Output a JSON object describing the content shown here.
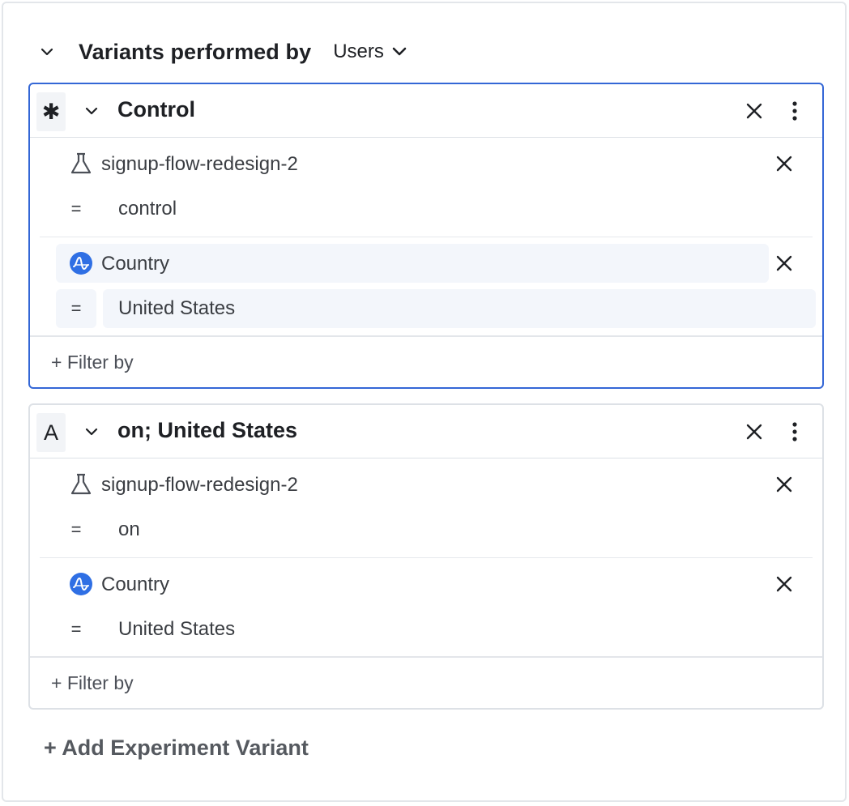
{
  "section": {
    "title": "Variants performed by",
    "scope_label": "Users"
  },
  "variants": [
    {
      "badge": "✱",
      "title": "Control",
      "filters": [
        {
          "icon": "flask-icon",
          "property": "signup-flow-redesign-2",
          "operator": "=",
          "value": "control"
        },
        {
          "icon": "amplitude-logo-icon",
          "property": "Country",
          "operator": "=",
          "value": "United States"
        }
      ],
      "filter_by_label": "+ Filter by"
    },
    {
      "badge": "A",
      "title": "on; United States",
      "filters": [
        {
          "icon": "flask-icon",
          "property": "signup-flow-redesign-2",
          "operator": "=",
          "value": "on"
        },
        {
          "icon": "amplitude-logo-icon",
          "property": "Country",
          "operator": "=",
          "value": "United States"
        }
      ],
      "filter_by_label": "+ Filter by"
    }
  ],
  "add_variant_label": "+ Add Experiment Variant",
  "colors": {
    "accent": "#3467d6",
    "amplitude_blue": "#2f6fe4",
    "hover_bg": "#f3f6fb"
  }
}
